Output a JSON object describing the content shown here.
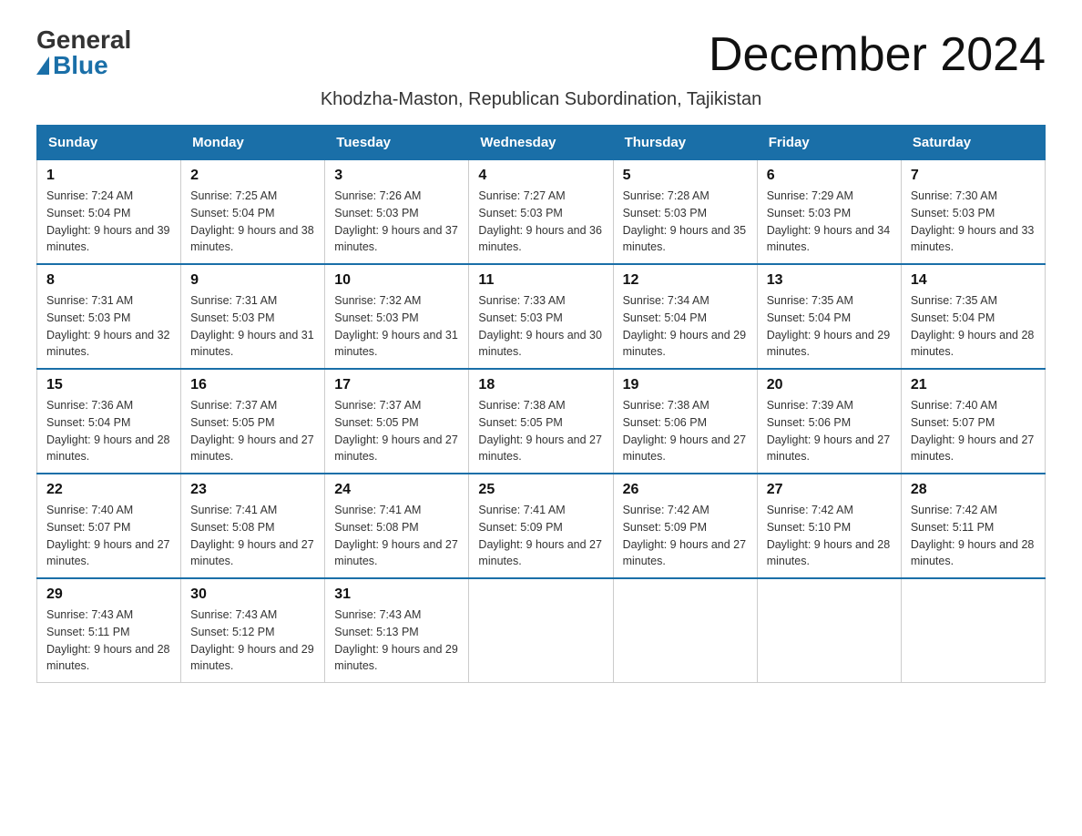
{
  "header": {
    "logo_general": "General",
    "logo_blue": "Blue",
    "month_title": "December 2024",
    "subtitle": "Khodzha-Maston, Republican Subordination, Tajikistan"
  },
  "days_of_week": [
    "Sunday",
    "Monday",
    "Tuesday",
    "Wednesday",
    "Thursday",
    "Friday",
    "Saturday"
  ],
  "weeks": [
    [
      {
        "num": "1",
        "sunrise": "7:24 AM",
        "sunset": "5:04 PM",
        "daylight": "9 hours and 39 minutes."
      },
      {
        "num": "2",
        "sunrise": "7:25 AM",
        "sunset": "5:04 PM",
        "daylight": "9 hours and 38 minutes."
      },
      {
        "num": "3",
        "sunrise": "7:26 AM",
        "sunset": "5:03 PM",
        "daylight": "9 hours and 37 minutes."
      },
      {
        "num": "4",
        "sunrise": "7:27 AM",
        "sunset": "5:03 PM",
        "daylight": "9 hours and 36 minutes."
      },
      {
        "num": "5",
        "sunrise": "7:28 AM",
        "sunset": "5:03 PM",
        "daylight": "9 hours and 35 minutes."
      },
      {
        "num": "6",
        "sunrise": "7:29 AM",
        "sunset": "5:03 PM",
        "daylight": "9 hours and 34 minutes."
      },
      {
        "num": "7",
        "sunrise": "7:30 AM",
        "sunset": "5:03 PM",
        "daylight": "9 hours and 33 minutes."
      }
    ],
    [
      {
        "num": "8",
        "sunrise": "7:31 AM",
        "sunset": "5:03 PM",
        "daylight": "9 hours and 32 minutes."
      },
      {
        "num": "9",
        "sunrise": "7:31 AM",
        "sunset": "5:03 PM",
        "daylight": "9 hours and 31 minutes."
      },
      {
        "num": "10",
        "sunrise": "7:32 AM",
        "sunset": "5:03 PM",
        "daylight": "9 hours and 31 minutes."
      },
      {
        "num": "11",
        "sunrise": "7:33 AM",
        "sunset": "5:03 PM",
        "daylight": "9 hours and 30 minutes."
      },
      {
        "num": "12",
        "sunrise": "7:34 AM",
        "sunset": "5:04 PM",
        "daylight": "9 hours and 29 minutes."
      },
      {
        "num": "13",
        "sunrise": "7:35 AM",
        "sunset": "5:04 PM",
        "daylight": "9 hours and 29 minutes."
      },
      {
        "num": "14",
        "sunrise": "7:35 AM",
        "sunset": "5:04 PM",
        "daylight": "9 hours and 28 minutes."
      }
    ],
    [
      {
        "num": "15",
        "sunrise": "7:36 AM",
        "sunset": "5:04 PM",
        "daylight": "9 hours and 28 minutes."
      },
      {
        "num": "16",
        "sunrise": "7:37 AM",
        "sunset": "5:05 PM",
        "daylight": "9 hours and 27 minutes."
      },
      {
        "num": "17",
        "sunrise": "7:37 AM",
        "sunset": "5:05 PM",
        "daylight": "9 hours and 27 minutes."
      },
      {
        "num": "18",
        "sunrise": "7:38 AM",
        "sunset": "5:05 PM",
        "daylight": "9 hours and 27 minutes."
      },
      {
        "num": "19",
        "sunrise": "7:38 AM",
        "sunset": "5:06 PM",
        "daylight": "9 hours and 27 minutes."
      },
      {
        "num": "20",
        "sunrise": "7:39 AM",
        "sunset": "5:06 PM",
        "daylight": "9 hours and 27 minutes."
      },
      {
        "num": "21",
        "sunrise": "7:40 AM",
        "sunset": "5:07 PM",
        "daylight": "9 hours and 27 minutes."
      }
    ],
    [
      {
        "num": "22",
        "sunrise": "7:40 AM",
        "sunset": "5:07 PM",
        "daylight": "9 hours and 27 minutes."
      },
      {
        "num": "23",
        "sunrise": "7:41 AM",
        "sunset": "5:08 PM",
        "daylight": "9 hours and 27 minutes."
      },
      {
        "num": "24",
        "sunrise": "7:41 AM",
        "sunset": "5:08 PM",
        "daylight": "9 hours and 27 minutes."
      },
      {
        "num": "25",
        "sunrise": "7:41 AM",
        "sunset": "5:09 PM",
        "daylight": "9 hours and 27 minutes."
      },
      {
        "num": "26",
        "sunrise": "7:42 AM",
        "sunset": "5:09 PM",
        "daylight": "9 hours and 27 minutes."
      },
      {
        "num": "27",
        "sunrise": "7:42 AM",
        "sunset": "5:10 PM",
        "daylight": "9 hours and 28 minutes."
      },
      {
        "num": "28",
        "sunrise": "7:42 AM",
        "sunset": "5:11 PM",
        "daylight": "9 hours and 28 minutes."
      }
    ],
    [
      {
        "num": "29",
        "sunrise": "7:43 AM",
        "sunset": "5:11 PM",
        "daylight": "9 hours and 28 minutes."
      },
      {
        "num": "30",
        "sunrise": "7:43 AM",
        "sunset": "5:12 PM",
        "daylight": "9 hours and 29 minutes."
      },
      {
        "num": "31",
        "sunrise": "7:43 AM",
        "sunset": "5:13 PM",
        "daylight": "9 hours and 29 minutes."
      },
      null,
      null,
      null,
      null
    ]
  ]
}
